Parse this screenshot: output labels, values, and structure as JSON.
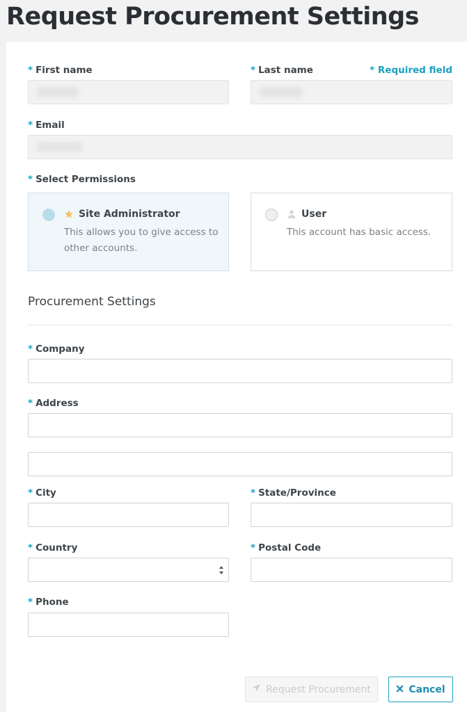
{
  "page_title": "Request Procurement Settings",
  "required_note": "* Required field",
  "required_marker": "*",
  "fields": {
    "first_name": {
      "label": "First name",
      "value": ""
    },
    "last_name": {
      "label": "Last name",
      "value": ""
    },
    "email": {
      "label": "Email",
      "value": ""
    }
  },
  "permissions": {
    "label": "Select Permissions",
    "options": [
      {
        "name": "Site Administrator",
        "description": "This allows you to give access to other accounts.",
        "icon": "star-icon",
        "selected": true
      },
      {
        "name": "User",
        "description": "This account has basic access.",
        "icon": "user-icon",
        "selected": false
      }
    ]
  },
  "procurement": {
    "title": "Procurement Settings",
    "company_label": "Company",
    "address_label": "Address",
    "city_label": "City",
    "state_label": "State/Province",
    "country_label": "Country",
    "postal_label": "Postal Code",
    "phone_label": "Phone"
  },
  "buttons": {
    "request": "Request Procurement",
    "cancel": "Cancel"
  },
  "colors": {
    "accent": "#1ba1bf",
    "selected_card_bg": "#f0f7fa",
    "star": "#f5c26b"
  }
}
